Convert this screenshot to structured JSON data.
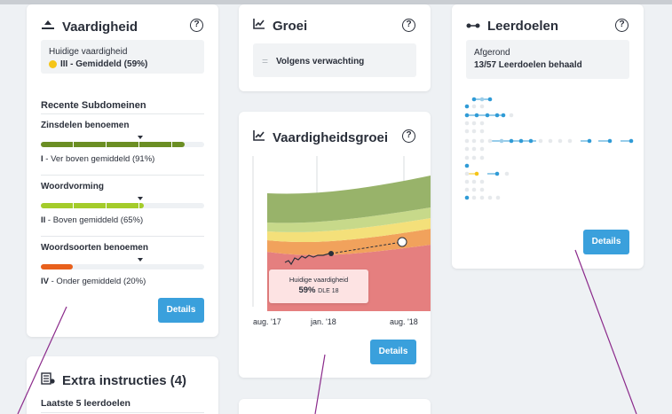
{
  "vaardigheid": {
    "title": "Vaardigheid",
    "help": "?",
    "current_label": "Huidige vaardigheid",
    "current_value": "III - Gemiddeld (59%)",
    "recent_title": "Recente Subdomeinen",
    "subdomains": [
      {
        "name": "Zinsdelen benoemen",
        "level": "I",
        "desc": " - Ver boven gemiddeld (91%)",
        "percent": 91,
        "color": "#6b8e23"
      },
      {
        "name": "Woordvorming",
        "level": "II",
        "desc": " - Boven gemiddeld (65%)",
        "percent": 65,
        "color": "#a4cc2a"
      },
      {
        "name": "Woordsoorten benoemen",
        "level": "IV",
        "desc": " - Onder gemiddeld (20%)",
        "percent": 20,
        "color": "#e8601c"
      }
    ],
    "details": "Details"
  },
  "groei": {
    "title": "Groei",
    "help": "?",
    "value": "Volgens verwachting"
  },
  "vaardigheidsgroei": {
    "title": "Vaardigheidsgroei",
    "help": "?",
    "tooltip_label": "Huidige vaardigheid",
    "tooltip_value": "59%",
    "tooltip_suffix": "DLE 18",
    "x_labels": [
      "aug. '17",
      "jan. '18",
      "aug. '18"
    ],
    "details": "Details"
  },
  "leerdoelen": {
    "title": "Leerdoelen",
    "help": "?",
    "status_label": "Afgerond",
    "status_value": "13/57 Leerdoelen behaald",
    "details": "Details"
  },
  "extra": {
    "title": "Extra instructies (4)",
    "subtitle": "Laatste 5 leerdoelen"
  },
  "colors": {
    "accent": "#3aa0dc",
    "level_mid": "#f5c518"
  }
}
